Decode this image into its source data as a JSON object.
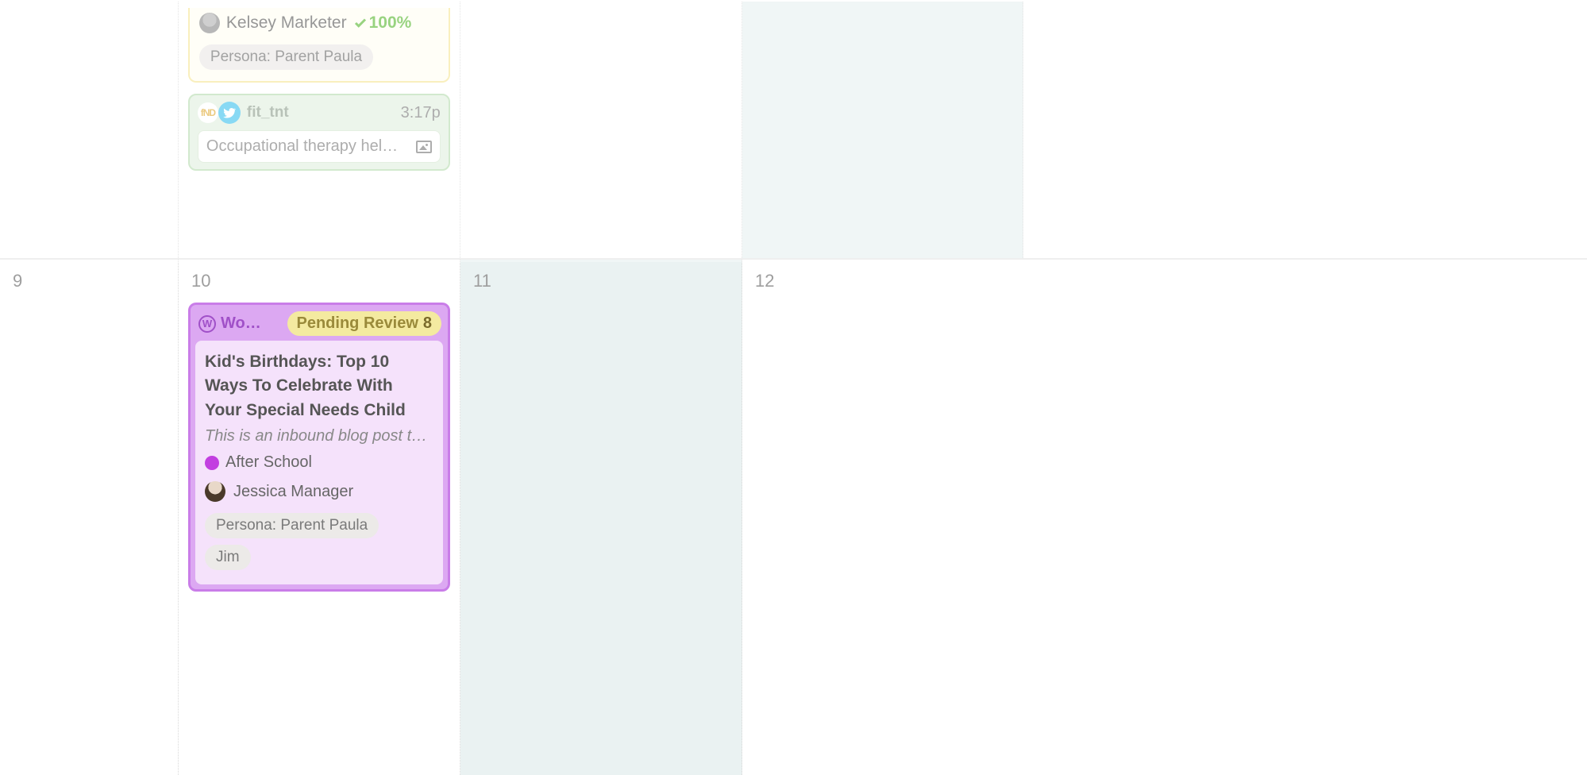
{
  "row1": {
    "days": [
      "",
      "",
      "",
      "",
      ""
    ],
    "yellowCard": {
      "assignee": "Kelsey Marketer",
      "completion": "100%",
      "tag": "Persona: Parent Paula"
    },
    "social": {
      "account": "fit_tnt",
      "time": "3:17p",
      "text": "Occupational therapy hel…"
    }
  },
  "row2": {
    "days": [
      "9",
      "10",
      "11",
      "12"
    ],
    "card": {
      "platform": "Wor…",
      "status": "Pending Review",
      "statusCount": "8",
      "title": "Kid's Birthdays: Top 10 Ways To Celebrate With Your Special Needs Child",
      "desc": "This is an inbound blog post t…",
      "category": "After School",
      "manager": "Jessica Manager",
      "tags": [
        "Persona: Parent Paula",
        "Jim"
      ]
    }
  }
}
